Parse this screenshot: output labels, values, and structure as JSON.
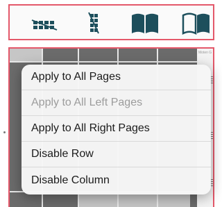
{
  "toolbar": {
    "tools": [
      {
        "icon": "strikethrough-row-icon"
      },
      {
        "icon": "strikethrough-column-icon"
      },
      {
        "icon": "open-book-filled-icon"
      },
      {
        "icon": "open-book-outline-icon"
      }
    ],
    "icon_color": "#1d4f5c"
  },
  "side_page": {
    "label": "Moten G"
  },
  "context_menu": {
    "items": [
      {
        "label": "Apply to All Pages",
        "enabled": true
      },
      {
        "label": "Apply to All Left Pages",
        "enabled": false
      },
      {
        "label": "Apply to All Right Pages",
        "enabled": true
      },
      {
        "label": "Disable Row",
        "enabled": true
      },
      {
        "label": "Disable Column",
        "enabled": true
      }
    ]
  },
  "colors": {
    "highlight_border": "#e4586a",
    "disabled_text": "#9c9c9c"
  }
}
